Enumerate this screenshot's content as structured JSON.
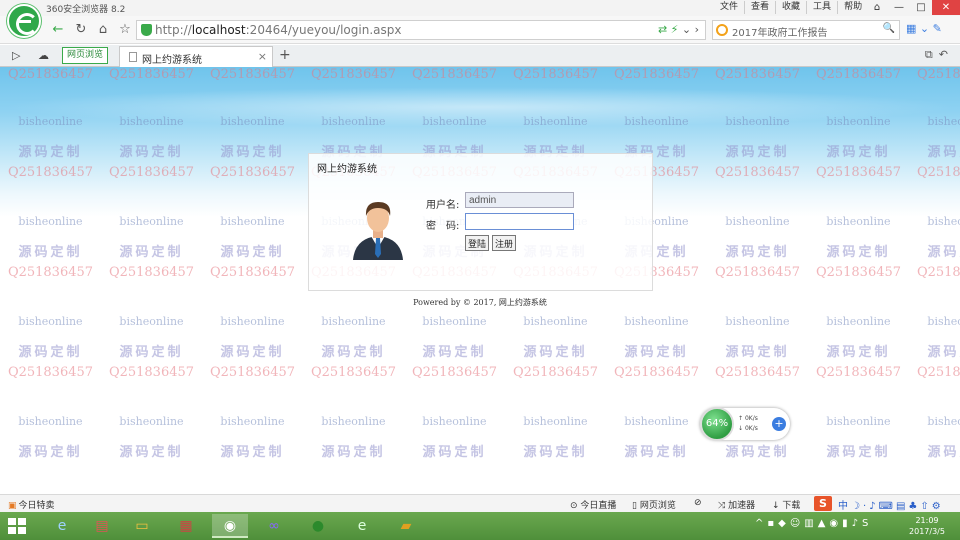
{
  "window": {
    "title": "360安全浏览器 8.2",
    "menu": [
      "文件",
      "查看",
      "收藏",
      "工具",
      "帮助"
    ],
    "controls": [
      "⌂",
      "—",
      "□",
      "✕"
    ]
  },
  "address_bar": {
    "url_host": "localhost",
    "url_prefix": "http://",
    "url_rest": ":20464/yueyou/login.aspx",
    "search_text": "2017年政府工作报告"
  },
  "tabs": {
    "green_tab_label": "网页浏览",
    "active_tab_title": "网上约游系统"
  },
  "login": {
    "panel_title": "网上约游系统",
    "username_label": "用户名:",
    "username_value": "admin",
    "password_label": "密　码:",
    "login_button": "登陆",
    "register_button": "注册",
    "footer": "Powered by © 2017, 网上约游系统"
  },
  "watermark": {
    "english": "bisheonline",
    "chinese": "源码定制",
    "qq": "Q2518364 57"
  },
  "speed_widget": {
    "percent": "64%",
    "up": "0K/s",
    "down": "0K/s"
  },
  "statusbar": {
    "left": "今日特卖",
    "items": [
      "今日直播",
      "网页浏览",
      "加速器",
      "下载"
    ]
  },
  "clock": {
    "time": "21:09",
    "date": "2017/3/5"
  },
  "colors": {
    "browser_green": "#3aaa4a",
    "taskbar": "#5a9a44",
    "sky_blue": "#8fd2f2"
  }
}
